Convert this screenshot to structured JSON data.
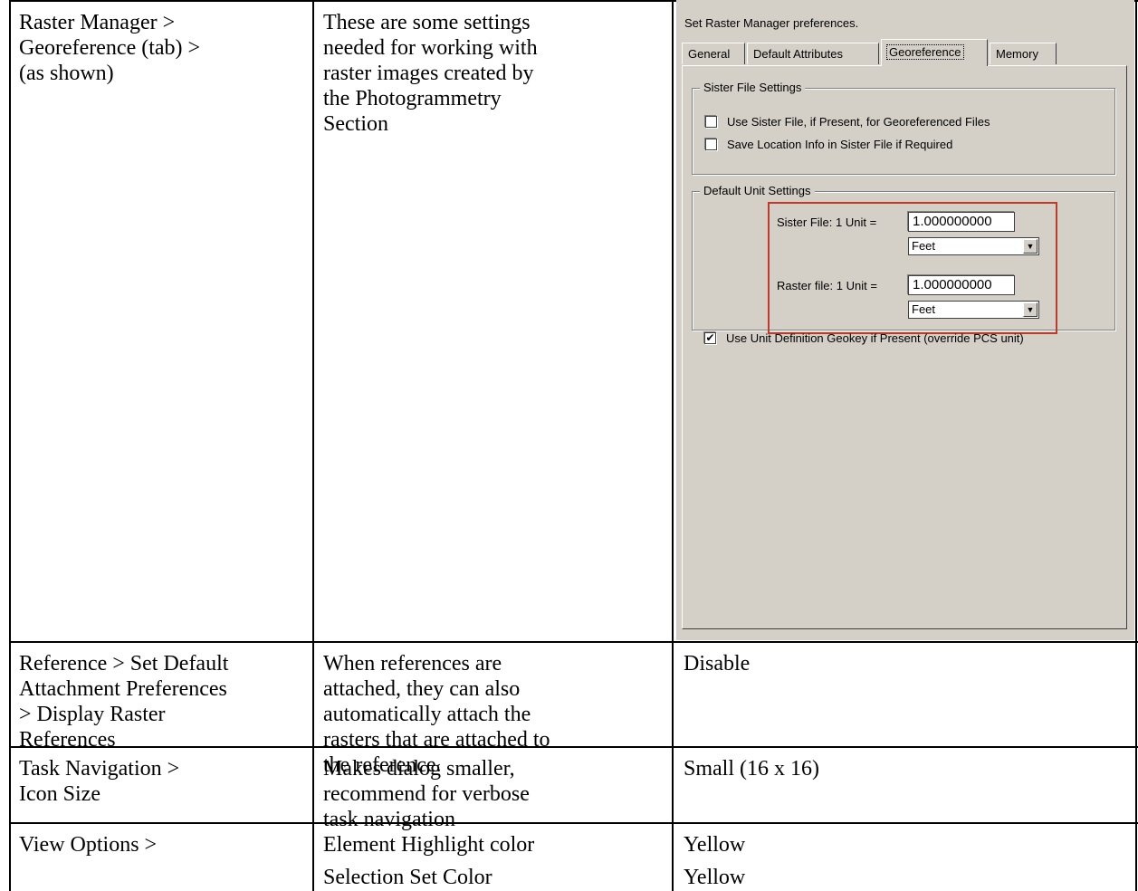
{
  "rows": [
    {
      "setting": [
        "Raster Manager >",
        "Georeference (tab) >",
        "(as shown)"
      ],
      "description": [
        "These are some settings",
        "needed for working with",
        "raster images created by",
        "the Photogrammetry",
        "Section"
      ]
    },
    {
      "setting": [
        "Reference > Set Default",
        "Attachment Preferences",
        "> Display Raster",
        "References"
      ],
      "description": [
        "When references are",
        "attached, they can also",
        "automatically attach the",
        "rasters that are attached to",
        "the reference."
      ],
      "value": "Disable"
    },
    {
      "setting": [
        "Task Navigation >",
        "Icon Size"
      ],
      "description": [
        "Makes dialog smaller,",
        "recommend for verbose",
        "task navigation"
      ],
      "value": "Small (16 x 16)"
    },
    {
      "setting": [
        "View Options >"
      ],
      "description": [
        "Element Highlight color",
        "Selection Set Color"
      ],
      "value": [
        "Yellow",
        "Yellow"
      ]
    }
  ],
  "dialog": {
    "header": "Set Raster Manager preferences.",
    "tabs": [
      "General",
      "Default Attributes",
      "Georeference",
      "Memory"
    ],
    "active_tab": "Georeference",
    "sister_group": {
      "title": "Sister File Settings",
      "use_sister_file": "Use Sister File, if Present, for Georeferenced Files",
      "use_sister_checked": false,
      "save_location": "Save Location Info in Sister File if Required",
      "save_location_checked": false
    },
    "unit_group": {
      "title": "Default Unit Settings",
      "sister_label": "Sister File: 1 Unit =",
      "sister_value": "1.000000000",
      "sister_unit": "Feet",
      "raster_label": "Raster file: 1 Unit =",
      "raster_value": "1.000000000",
      "raster_unit": "Feet",
      "geokey_label": "Use Unit Definition Geokey if Present (override PCS unit)",
      "geokey_checked": true,
      "check_mark": "✔",
      "highlight_color": "#c0392b"
    }
  }
}
